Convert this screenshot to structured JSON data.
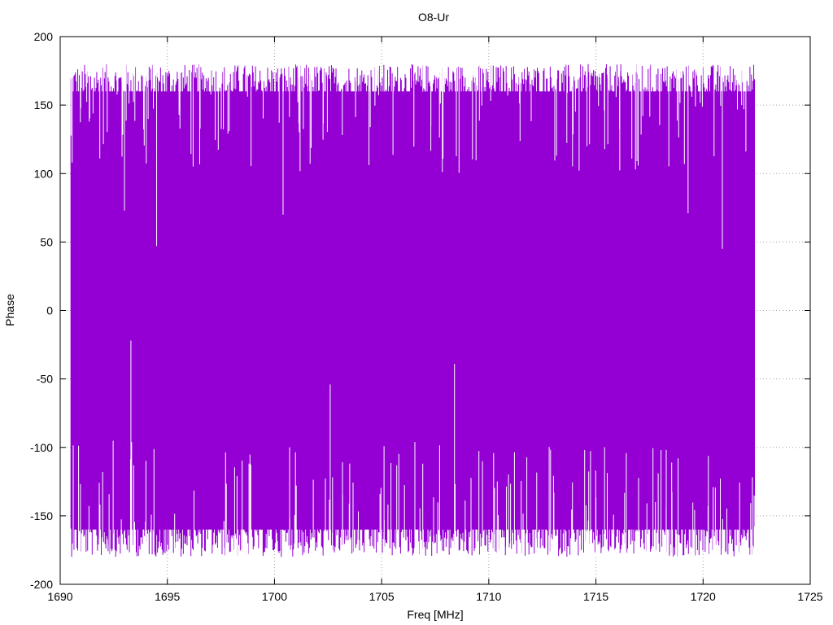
{
  "chart_data": {
    "type": "line",
    "title": "O8-Ur",
    "xlabel": "Freq [MHz]",
    "ylabel": "Phase",
    "xlim": [
      1690,
      1725
    ],
    "ylim": [
      -200,
      200
    ],
    "xticks": [
      1690,
      1695,
      1700,
      1705,
      1710,
      1715,
      1720,
      1725
    ],
    "yticks": [
      -200,
      -150,
      -100,
      -50,
      0,
      50,
      100,
      150,
      200
    ],
    "grid": true,
    "legend": "none",
    "series": [
      {
        "color": "#9400d3",
        "x_range": [
          1690.5,
          1722.4
        ],
        "envelope": {
          "typical_max": 170,
          "typical_min": -170,
          "extreme_max": 180,
          "extreme_min": -180
        },
        "notable_dips": [
          {
            "x": 1693.3,
            "y": -22
          },
          {
            "x": 1702.6,
            "y": -54
          },
          {
            "x": 1708.4,
            "y": -39
          },
          {
            "x": 1694.5,
            "y": 47
          },
          {
            "x": 1720.9,
            "y": 45
          },
          {
            "x": 1700.4,
            "y": 70
          },
          {
            "x": 1719.3,
            "y": 71
          },
          {
            "x": 1693.0,
            "y": 73
          }
        ]
      }
    ]
  }
}
